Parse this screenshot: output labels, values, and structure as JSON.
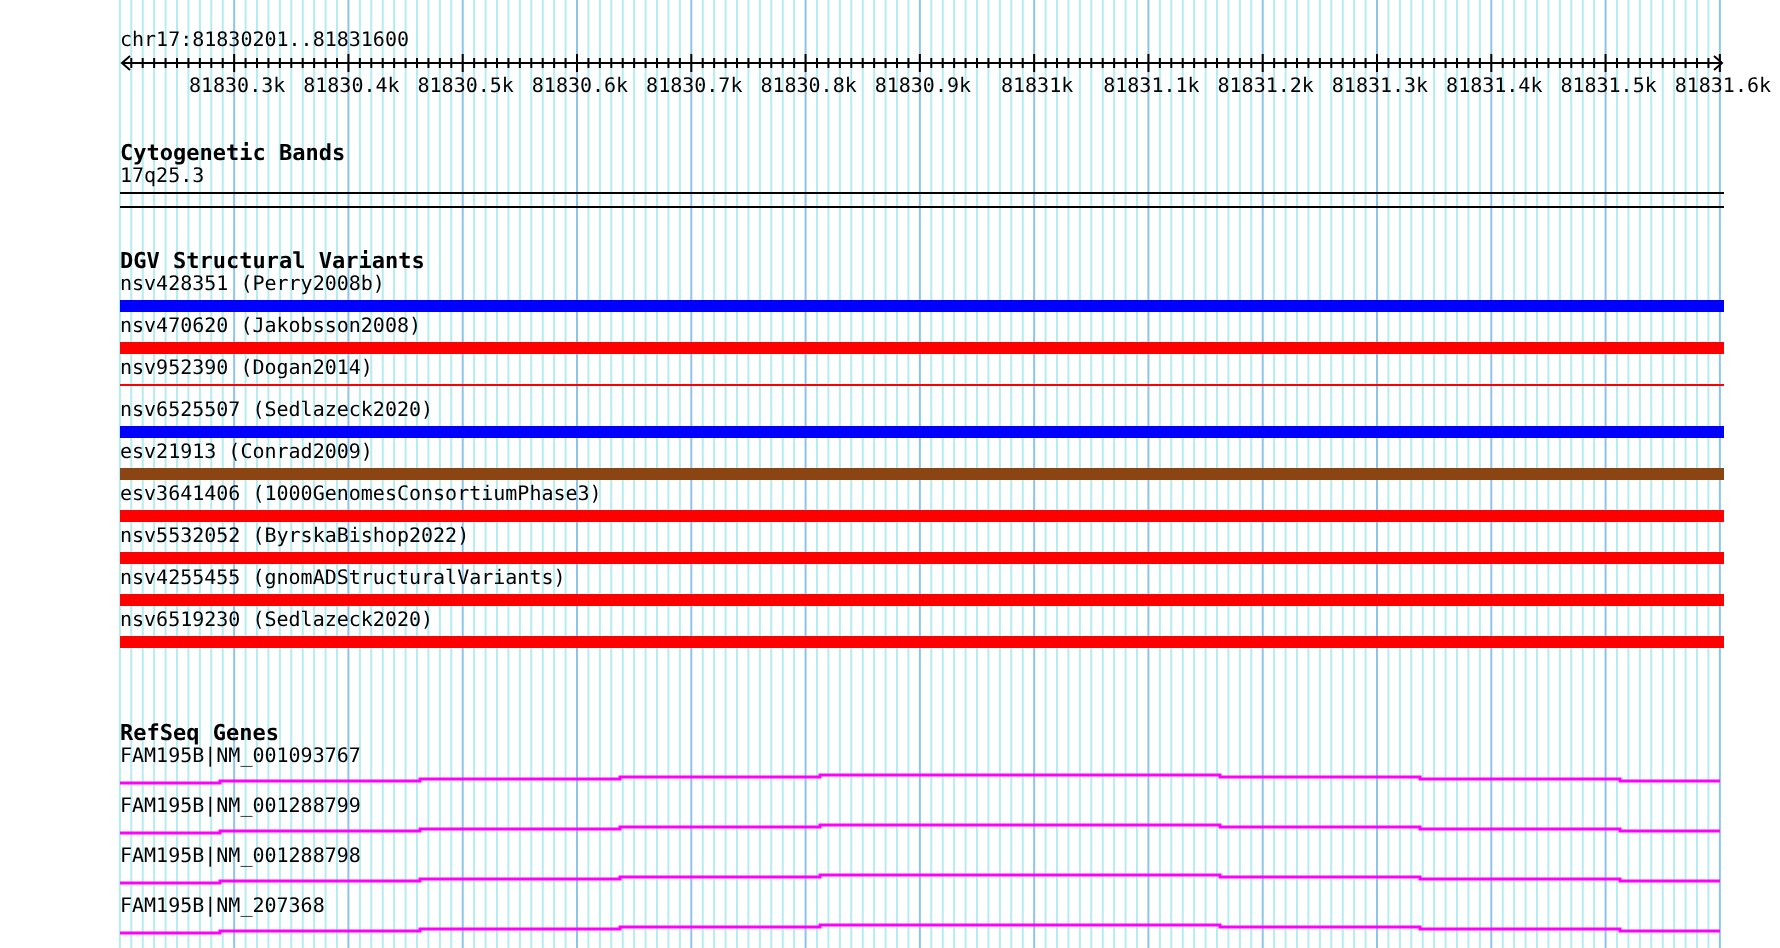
{
  "location": "chr17:81830201..81831600",
  "ruler": {
    "ticks": [
      "81830.3k",
      "81830.4k",
      "81830.5k",
      "81830.6k",
      "81830.7k",
      "81830.8k",
      "81830.9k",
      "81831k",
      "81831.1k",
      "81831.2k",
      "81831.3k",
      "81831.4k",
      "81831.5k",
      "81831.6k"
    ]
  },
  "cytoband_track": {
    "title": "Cytogenetic Bands",
    "band": "17q25.3"
  },
  "dgv_track": {
    "title": "DGV Structural Variants",
    "variants": [
      {
        "label": "nsv428351 (Perry2008b)",
        "color": "#0000ff",
        "kind": "thick"
      },
      {
        "label": "nsv470620 (Jakobsson2008)",
        "color": "#ff0000",
        "kind": "thick"
      },
      {
        "label": "nsv952390 (Dogan2014)",
        "color": "#ff0000",
        "kind": "thin"
      },
      {
        "label": "nsv6525507 (Sedlazeck2020)",
        "color": "#0000ff",
        "kind": "thick"
      },
      {
        "label": "esv21913 (Conrad2009)",
        "color": "#8b4513",
        "kind": "thick"
      },
      {
        "label": "esv3641406 (1000GenomesConsortiumPhase3)",
        "color": "#ff0000",
        "kind": "thick"
      },
      {
        "label": "nsv5532052 (ByrskaBishop2022)",
        "color": "#ff0000",
        "kind": "thick"
      },
      {
        "label": "nsv4255455 (gnomADStructuralVariants)",
        "color": "#ff0000",
        "kind": "thick"
      },
      {
        "label": "nsv6519230 (Sedlazeck2020)",
        "color": "#ff0000",
        "kind": "thick"
      }
    ]
  },
  "refseq_track": {
    "title": "RefSeq Genes",
    "genes": [
      {
        "label": "FAM195B|NM_001093767"
      },
      {
        "label": "FAM195B|NM_001288799"
      },
      {
        "label": "FAM195B|NM_001288798"
      },
      {
        "label": "FAM195B|NM_207368"
      }
    ]
  }
}
